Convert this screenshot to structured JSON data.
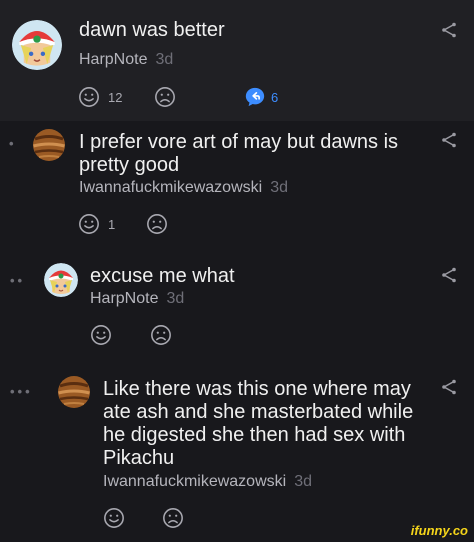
{
  "comments": [
    {
      "text": "dawn was better",
      "author": "HarpNote",
      "age": "3d",
      "likes": "12",
      "replies": "6",
      "avatar_icon": "pokemon-trainer-avatar"
    },
    {
      "text": "I prefer vore art of may but dawns is pretty good",
      "author": "Iwannafuckmikewazowski",
      "age": "3d",
      "likes": "1",
      "avatar_icon": "brown-striped-sphere-avatar"
    },
    {
      "text": "excuse me what",
      "author": "HarpNote",
      "age": "3d",
      "avatar_icon": "pokemon-trainer-avatar"
    },
    {
      "text": "Like there was this one where may ate ash and she masterbated while he digested she then had sex with Pikachu",
      "author": "Iwannafuckmikewazowski",
      "age": "3d",
      "avatar_icon": "brown-striped-sphere-avatar"
    }
  ],
  "watermark": "ifunny.co",
  "colors": {
    "background": "#18181c",
    "highlight": "#202024",
    "reply_accent": "#3d8dff",
    "watermark": "#f5d51a"
  }
}
